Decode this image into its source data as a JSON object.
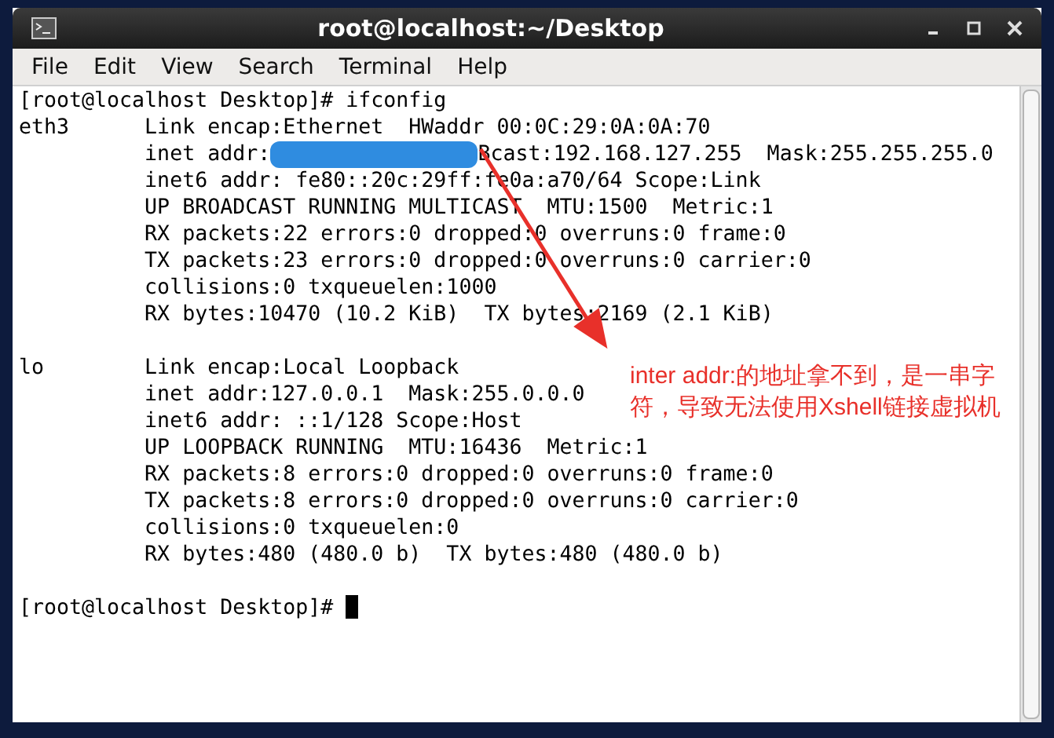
{
  "window": {
    "title": "root@localhost:~/Desktop"
  },
  "menu": [
    "File",
    "Edit",
    "View",
    "Search",
    "Terminal",
    "Help"
  ],
  "terminal": {
    "lines": [
      {
        "kind": "text",
        "text": "[root@localhost Desktop]# ifconfig"
      },
      {
        "kind": "text",
        "text": "eth3      Link encap:Ethernet  HWaddr 00:0C:29:0A:0A:70"
      },
      {
        "kind": "redacted",
        "text": "          inet addr:",
        "rest": "Bcast:192.168.127.255  Mask:255.255.255.0"
      },
      {
        "kind": "text",
        "text": "          inet6 addr: fe80::20c:29ff:fe0a:a70/64 Scope:Link"
      },
      {
        "kind": "text",
        "text": "          UP BROADCAST RUNNING MULTICAST  MTU:1500  Metric:1"
      },
      {
        "kind": "text",
        "text": "          RX packets:22 errors:0 dropped:0 overruns:0 frame:0"
      },
      {
        "kind": "text",
        "text": "          TX packets:23 errors:0 dropped:0 overruns:0 carrier:0"
      },
      {
        "kind": "text",
        "text": "          collisions:0 txqueuelen:1000"
      },
      {
        "kind": "text",
        "text": "          RX bytes:10470 (10.2 KiB)  TX bytes:2169 (2.1 KiB)"
      },
      {
        "kind": "blank"
      },
      {
        "kind": "text",
        "text": "lo        Link encap:Local Loopback"
      },
      {
        "kind": "text",
        "text": "          inet addr:127.0.0.1  Mask:255.0.0.0"
      },
      {
        "kind": "text",
        "text": "          inet6 addr: ::1/128 Scope:Host"
      },
      {
        "kind": "text",
        "text": "          UP LOOPBACK RUNNING  MTU:16436  Metric:1"
      },
      {
        "kind": "text",
        "text": "          RX packets:8 errors:0 dropped:0 overruns:0 frame:0"
      },
      {
        "kind": "text",
        "text": "          TX packets:8 errors:0 dropped:0 overruns:0 carrier:0"
      },
      {
        "kind": "text",
        "text": "          collisions:0 txqueuelen:0"
      },
      {
        "kind": "text",
        "text": "          RX bytes:480 (480.0 b)  TX bytes:480 (480.0 b)"
      },
      {
        "kind": "blank"
      },
      {
        "kind": "prompt",
        "text": "[root@localhost Desktop]# ",
        "cursor": true
      }
    ]
  },
  "annotation": {
    "text": "inter addr:的地址拿不到，是一串字符，导致无法使用Xshell链接虚拟机",
    "color": "#e8302a"
  }
}
